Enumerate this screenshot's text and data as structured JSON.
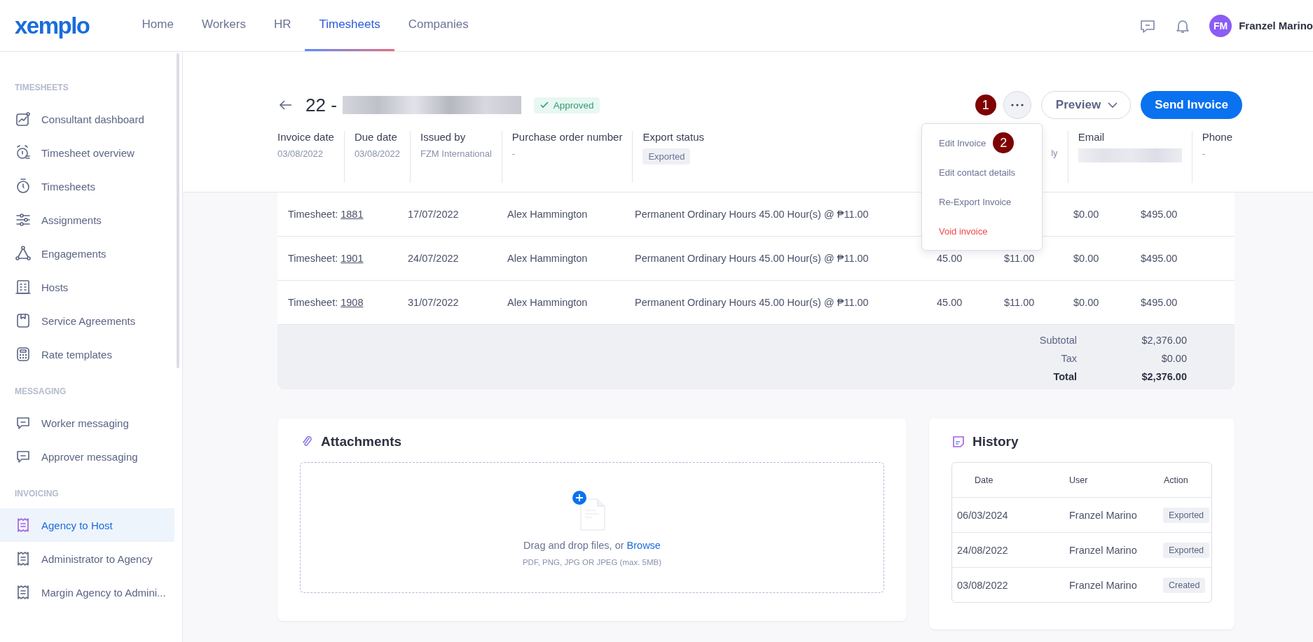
{
  "nav": {
    "logo": "xemplo",
    "items": [
      {
        "label": "Home",
        "selected": false
      },
      {
        "label": "Workers",
        "selected": false
      },
      {
        "label": "HR",
        "selected": false
      },
      {
        "label": "Timesheets",
        "selected": true
      },
      {
        "label": "Companies",
        "selected": false
      }
    ],
    "user": {
      "initials": "FM",
      "name": "Franzel Marino"
    }
  },
  "sidebar": {
    "sections": [
      {
        "heading": "TIMESHEETS",
        "items": [
          {
            "label": "Consultant dashboard",
            "selected": false
          },
          {
            "label": "Timesheet overview",
            "selected": false
          },
          {
            "label": "Timesheets",
            "selected": false
          },
          {
            "label": "Assignments",
            "selected": false
          },
          {
            "label": "Engagements",
            "selected": false
          },
          {
            "label": "Hosts",
            "selected": false
          },
          {
            "label": "Service Agreements",
            "selected": false
          },
          {
            "label": "Rate templates",
            "selected": false
          }
        ]
      },
      {
        "heading": "MESSAGING",
        "items": [
          {
            "label": "Worker messaging",
            "selected": false
          },
          {
            "label": "Approver messaging",
            "selected": false
          }
        ]
      },
      {
        "heading": "INVOICING",
        "items": [
          {
            "label": "Agency to Host",
            "selected": true
          },
          {
            "label": "Administrator to Agency",
            "selected": false
          },
          {
            "label": "Margin Agency to Admini...",
            "selected": false
          }
        ]
      }
    ]
  },
  "invoice": {
    "title": "22 -",
    "status": "Approved",
    "details": [
      {
        "label": "Invoice date",
        "value": "03/08/2022",
        "kind": "text"
      },
      {
        "label": "Due date",
        "value": "03/08/2022",
        "kind": "text"
      },
      {
        "label": "Issued by",
        "value": "FZM International",
        "kind": "text"
      },
      {
        "label": "Purchase order number",
        "value": "-",
        "kind": "text"
      },
      {
        "label": "Export status",
        "value": "Exported",
        "kind": "tag"
      }
    ],
    "details_right": [
      {
        "value": "ly",
        "kind": "text"
      },
      {
        "label": "Email",
        "kind": "redacted"
      },
      {
        "label": "Phone",
        "value": "-",
        "kind": "text"
      }
    ]
  },
  "actions": {
    "step_badge": "1",
    "preview": "Preview",
    "send": "Send Invoice"
  },
  "menu": {
    "items": [
      {
        "label": "Edit Invoice",
        "kind": "normal",
        "step_badge": "2"
      },
      {
        "label": "Edit contact details",
        "kind": "normal"
      },
      {
        "label": "Re-Export Invoice",
        "kind": "normal"
      },
      {
        "label": "Void invoice",
        "kind": "danger"
      }
    ]
  },
  "table": {
    "rows": [
      {
        "timesheet_label": "Timesheet:",
        "timesheet_link": "1881",
        "date": "17/07/2022",
        "worker": "Alex Hammington",
        "description": "Permanent Ordinary Hours 45.00 Hour(s) @ ₱11.00",
        "tax": "$0.00",
        "amount": "$495.00"
      },
      {
        "timesheet_label": "Timesheet:",
        "timesheet_link": "1901",
        "date": "24/07/2022",
        "worker": "Alex Hammington",
        "description": "Permanent Ordinary Hours 45.00 Hour(s) @ ₱11.00",
        "quantity": "45.00",
        "rate": "$11.00",
        "tax": "$0.00",
        "amount": "$495.00"
      },
      {
        "timesheet_label": "Timesheet:",
        "timesheet_link": "1908",
        "date": "31/07/2022",
        "worker": "Alex Hammington",
        "description": "Permanent Ordinary Hours 45.00 Hour(s) @ ₱11.00",
        "quantity": "45.00",
        "rate": "$11.00",
        "tax": "$0.00",
        "amount": "$495.00"
      }
    ],
    "totals": [
      {
        "label": "Subtotal",
        "value": "$2,376.00",
        "kind": "normal"
      },
      {
        "label": "Tax",
        "value": "$0.00",
        "kind": "normal"
      },
      {
        "label": "Total",
        "value": "$2,376.00",
        "kind": "bold"
      }
    ]
  },
  "attachments": {
    "title": "Attachments",
    "prompt": "Drag and drop files, or",
    "link": "Browse",
    "hint": "PDF, PNG, JPG OR JPEG (max. 5MB)"
  },
  "history": {
    "title": "History",
    "columns": [
      "Date",
      "User",
      "Action"
    ],
    "rows": [
      {
        "date": "06/03/2024",
        "user": "Franzel Marino",
        "action": "Exported"
      },
      {
        "date": "24/08/2022",
        "user": "Franzel Marino",
        "action": "Exported"
      },
      {
        "date": "03/08/2022",
        "user": "Franzel Marino",
        "action": "Created"
      }
    ]
  }
}
